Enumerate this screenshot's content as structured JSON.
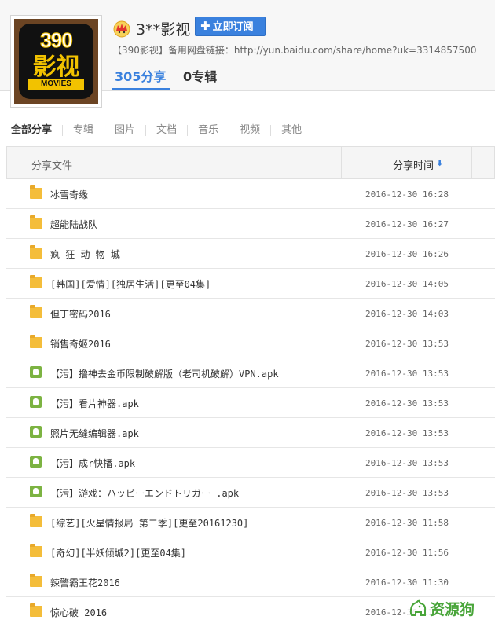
{
  "profile": {
    "logo_number": "390",
    "logo_text": "影视",
    "logo_subtext": "MOVIES",
    "username": "3**影视",
    "subscribe_label": "立即订阅",
    "backup_link": "【390影视】备用网盘链接：http://yun.baidu.com/share/home?uk=3314857500",
    "shares_count": "305",
    "shares_label": "分享",
    "albums_count": "0",
    "albums_label": "专辑"
  },
  "filter_tabs": [
    "全部分享",
    "专辑",
    "图片",
    "文档",
    "音乐",
    "视频",
    "其他"
  ],
  "table": {
    "col_file": "分享文件",
    "col_time": "分享时间",
    "sort_icon": "arrow-down-icon",
    "rows": [
      {
        "type": "folder",
        "name": "冰雪奇缘",
        "time": "2016-12-30 16:28"
      },
      {
        "type": "folder",
        "name": "超能陆战队",
        "time": "2016-12-30 16:27"
      },
      {
        "type": "folder",
        "name": "疯 狂 动 物 城",
        "time": "2016-12-30 16:26"
      },
      {
        "type": "folder",
        "name": "[韩国][爱情][独居生活][更至04集]",
        "time": "2016-12-30 14:05"
      },
      {
        "type": "folder",
        "name": "但丁密码2016",
        "time": "2016-12-30 14:03"
      },
      {
        "type": "folder",
        "name": "销售奇姬2016",
        "time": "2016-12-30 13:53"
      },
      {
        "type": "apk",
        "name": "【污】撸神去金币限制破解版（老司机破解）VPN.apk",
        "time": "2016-12-30 13:53"
      },
      {
        "type": "apk",
        "name": "【污】看片神器.apk",
        "time": "2016-12-30 13:53"
      },
      {
        "type": "apk",
        "name": "照片无缝编辑器.apk",
        "time": "2016-12-30 13:53"
      },
      {
        "type": "apk",
        "name": "【污】成r快播.apk",
        "time": "2016-12-30 13:53"
      },
      {
        "type": "apk",
        "name": "【污】游戏：ハッピーエンドトリガー .apk",
        "time": "2016-12-30 13:53"
      },
      {
        "type": "folder",
        "name": "[综艺][火星情报局 第二季][更至20161230]",
        "time": "2016-12-30 11:58"
      },
      {
        "type": "folder",
        "name": "[奇幻][半妖倾城2][更至04集]",
        "time": "2016-12-30 11:56"
      },
      {
        "type": "folder",
        "name": "辣警霸王花2016",
        "time": "2016-12-30 11:30"
      },
      {
        "type": "folder",
        "name": "惊心破 2016",
        "time": "2016-12-30 11:19"
      }
    ]
  },
  "watermark": {
    "text": "资源狗",
    "icon": "dog-icon"
  },
  "colors": {
    "accent": "#3a81de",
    "folder": "#f4bd3a",
    "android": "#7cb342",
    "watermark": "#49a53a"
  }
}
